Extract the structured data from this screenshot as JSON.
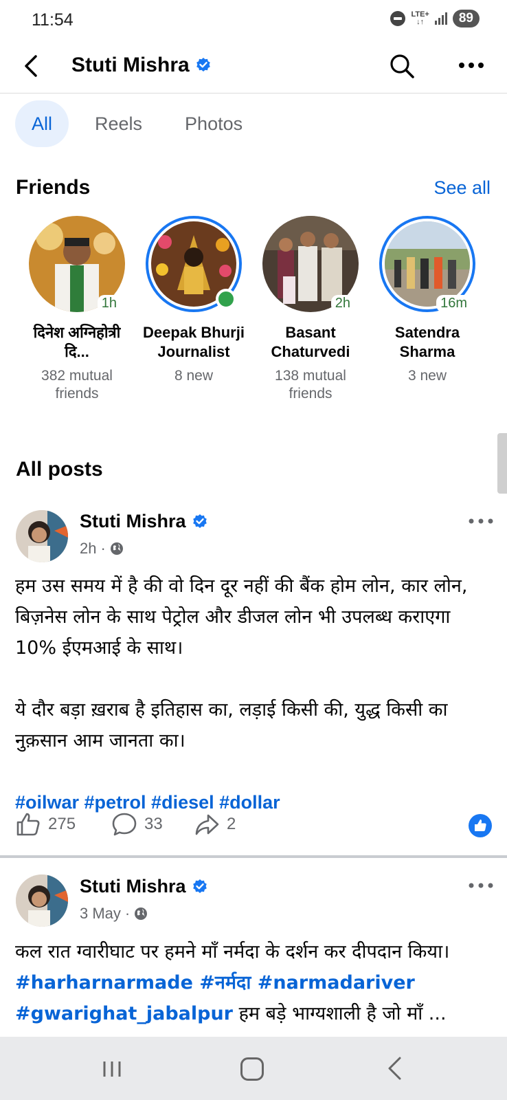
{
  "status_bar": {
    "time": "11:54",
    "network": "LTE+",
    "battery": "89"
  },
  "header": {
    "title": "Stuti Mishra",
    "verified": true,
    "icons": [
      "back-icon",
      "search-icon",
      "more-icon"
    ]
  },
  "tabs": [
    {
      "label": "All",
      "active": true
    },
    {
      "label": "Reels",
      "active": false
    },
    {
      "label": "Photos",
      "active": false
    }
  ],
  "friends": {
    "title": "Friends",
    "see_all": "See all",
    "items": [
      {
        "name": "दिनेश अग्निहोत्री दि...",
        "sub": "382 mutual friends",
        "badge": "1h",
        "ring": false,
        "online": false
      },
      {
        "name": "Deepak Bhurji Journalist",
        "sub": "8 new",
        "badge": "",
        "ring": true,
        "online": true
      },
      {
        "name": "Basant Chaturvedi",
        "sub": "138 mutual friends",
        "badge": "2h",
        "ring": false,
        "online": false
      },
      {
        "name": "Satendra Sharma",
        "sub": "3 new",
        "badge": "16m",
        "ring": true,
        "online": false
      }
    ]
  },
  "all_posts_title": "All posts",
  "posts": [
    {
      "author": "Stuti Mishra",
      "time": "2h",
      "privacy": "public",
      "paragraphs": [
        "हम उस समय में है की वो दिन दूर नहीं की बैंक होम लोन, कार लोन, बिज़नेस लोन के साथ पेट्रोल और डीजल लोन भी उपलब्ध कराएगा 10% ईएमआई के साथ।",
        "ये दौर बड़ा ख़राब है इतिहास का, लड़ाई किसी की, युद्ध किसी का नुक़सान आम जानता का।"
      ],
      "hashtags": "#oilwar #petrol #diesel #dollar",
      "likes": "275",
      "comments": "33",
      "shares": "2"
    },
    {
      "author": "Stuti Mishra",
      "time": "3 May",
      "privacy": "public",
      "text_start": "कल रात ग्वारीघाट पर हमने माँ नर्मदा के दर्शन कर दीपदान किया। ",
      "tags_inline": "#harharnarmade #नर्मदा #narmadariver #gwarighat_jabalpur",
      "text_end": " हम बड़े भाग्यशाली है जो माँ ..."
    }
  ],
  "colors": {
    "accent": "#0864d6",
    "verified": "#1877f2",
    "muted": "#65676b",
    "online": "#31a24c"
  }
}
